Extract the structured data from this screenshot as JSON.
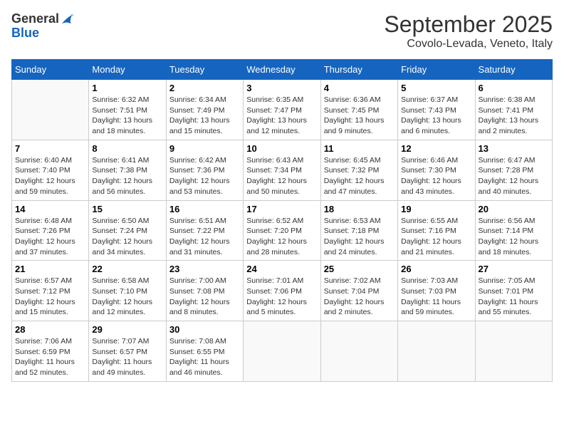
{
  "logo": {
    "general": "General",
    "blue": "Blue"
  },
  "header": {
    "month": "September 2025",
    "location": "Covolo-Levada, Veneto, Italy"
  },
  "weekdays": [
    "Sunday",
    "Monday",
    "Tuesday",
    "Wednesday",
    "Thursday",
    "Friday",
    "Saturday"
  ],
  "weeks": [
    [
      {
        "day": "",
        "sunrise": "",
        "sunset": "",
        "daylight": ""
      },
      {
        "day": "1",
        "sunrise": "Sunrise: 6:32 AM",
        "sunset": "Sunset: 7:51 PM",
        "daylight": "Daylight: 13 hours and 18 minutes."
      },
      {
        "day": "2",
        "sunrise": "Sunrise: 6:34 AM",
        "sunset": "Sunset: 7:49 PM",
        "daylight": "Daylight: 13 hours and 15 minutes."
      },
      {
        "day": "3",
        "sunrise": "Sunrise: 6:35 AM",
        "sunset": "Sunset: 7:47 PM",
        "daylight": "Daylight: 13 hours and 12 minutes."
      },
      {
        "day": "4",
        "sunrise": "Sunrise: 6:36 AM",
        "sunset": "Sunset: 7:45 PM",
        "daylight": "Daylight: 13 hours and 9 minutes."
      },
      {
        "day": "5",
        "sunrise": "Sunrise: 6:37 AM",
        "sunset": "Sunset: 7:43 PM",
        "daylight": "Daylight: 13 hours and 6 minutes."
      },
      {
        "day": "6",
        "sunrise": "Sunrise: 6:38 AM",
        "sunset": "Sunset: 7:41 PM",
        "daylight": "Daylight: 13 hours and 2 minutes."
      }
    ],
    [
      {
        "day": "7",
        "sunrise": "Sunrise: 6:40 AM",
        "sunset": "Sunset: 7:40 PM",
        "daylight": "Daylight: 12 hours and 59 minutes."
      },
      {
        "day": "8",
        "sunrise": "Sunrise: 6:41 AM",
        "sunset": "Sunset: 7:38 PM",
        "daylight": "Daylight: 12 hours and 56 minutes."
      },
      {
        "day": "9",
        "sunrise": "Sunrise: 6:42 AM",
        "sunset": "Sunset: 7:36 PM",
        "daylight": "Daylight: 12 hours and 53 minutes."
      },
      {
        "day": "10",
        "sunrise": "Sunrise: 6:43 AM",
        "sunset": "Sunset: 7:34 PM",
        "daylight": "Daylight: 12 hours and 50 minutes."
      },
      {
        "day": "11",
        "sunrise": "Sunrise: 6:45 AM",
        "sunset": "Sunset: 7:32 PM",
        "daylight": "Daylight: 12 hours and 47 minutes."
      },
      {
        "day": "12",
        "sunrise": "Sunrise: 6:46 AM",
        "sunset": "Sunset: 7:30 PM",
        "daylight": "Daylight: 12 hours and 43 minutes."
      },
      {
        "day": "13",
        "sunrise": "Sunrise: 6:47 AM",
        "sunset": "Sunset: 7:28 PM",
        "daylight": "Daylight: 12 hours and 40 minutes."
      }
    ],
    [
      {
        "day": "14",
        "sunrise": "Sunrise: 6:48 AM",
        "sunset": "Sunset: 7:26 PM",
        "daylight": "Daylight: 12 hours and 37 minutes."
      },
      {
        "day": "15",
        "sunrise": "Sunrise: 6:50 AM",
        "sunset": "Sunset: 7:24 PM",
        "daylight": "Daylight: 12 hours and 34 minutes."
      },
      {
        "day": "16",
        "sunrise": "Sunrise: 6:51 AM",
        "sunset": "Sunset: 7:22 PM",
        "daylight": "Daylight: 12 hours and 31 minutes."
      },
      {
        "day": "17",
        "sunrise": "Sunrise: 6:52 AM",
        "sunset": "Sunset: 7:20 PM",
        "daylight": "Daylight: 12 hours and 28 minutes."
      },
      {
        "day": "18",
        "sunrise": "Sunrise: 6:53 AM",
        "sunset": "Sunset: 7:18 PM",
        "daylight": "Daylight: 12 hours and 24 minutes."
      },
      {
        "day": "19",
        "sunrise": "Sunrise: 6:55 AM",
        "sunset": "Sunset: 7:16 PM",
        "daylight": "Daylight: 12 hours and 21 minutes."
      },
      {
        "day": "20",
        "sunrise": "Sunrise: 6:56 AM",
        "sunset": "Sunset: 7:14 PM",
        "daylight": "Daylight: 12 hours and 18 minutes."
      }
    ],
    [
      {
        "day": "21",
        "sunrise": "Sunrise: 6:57 AM",
        "sunset": "Sunset: 7:12 PM",
        "daylight": "Daylight: 12 hours and 15 minutes."
      },
      {
        "day": "22",
        "sunrise": "Sunrise: 6:58 AM",
        "sunset": "Sunset: 7:10 PM",
        "daylight": "Daylight: 12 hours and 12 minutes."
      },
      {
        "day": "23",
        "sunrise": "Sunrise: 7:00 AM",
        "sunset": "Sunset: 7:08 PM",
        "daylight": "Daylight: 12 hours and 8 minutes."
      },
      {
        "day": "24",
        "sunrise": "Sunrise: 7:01 AM",
        "sunset": "Sunset: 7:06 PM",
        "daylight": "Daylight: 12 hours and 5 minutes."
      },
      {
        "day": "25",
        "sunrise": "Sunrise: 7:02 AM",
        "sunset": "Sunset: 7:04 PM",
        "daylight": "Daylight: 12 hours and 2 minutes."
      },
      {
        "day": "26",
        "sunrise": "Sunrise: 7:03 AM",
        "sunset": "Sunset: 7:03 PM",
        "daylight": "Daylight: 11 hours and 59 minutes."
      },
      {
        "day": "27",
        "sunrise": "Sunrise: 7:05 AM",
        "sunset": "Sunset: 7:01 PM",
        "daylight": "Daylight: 11 hours and 55 minutes."
      }
    ],
    [
      {
        "day": "28",
        "sunrise": "Sunrise: 7:06 AM",
        "sunset": "Sunset: 6:59 PM",
        "daylight": "Daylight: 11 hours and 52 minutes."
      },
      {
        "day": "29",
        "sunrise": "Sunrise: 7:07 AM",
        "sunset": "Sunset: 6:57 PM",
        "daylight": "Daylight: 11 hours and 49 minutes."
      },
      {
        "day": "30",
        "sunrise": "Sunrise: 7:08 AM",
        "sunset": "Sunset: 6:55 PM",
        "daylight": "Daylight: 11 hours and 46 minutes."
      },
      {
        "day": "",
        "sunrise": "",
        "sunset": "",
        "daylight": ""
      },
      {
        "day": "",
        "sunrise": "",
        "sunset": "",
        "daylight": ""
      },
      {
        "day": "",
        "sunrise": "",
        "sunset": "",
        "daylight": ""
      },
      {
        "day": "",
        "sunrise": "",
        "sunset": "",
        "daylight": ""
      }
    ]
  ]
}
